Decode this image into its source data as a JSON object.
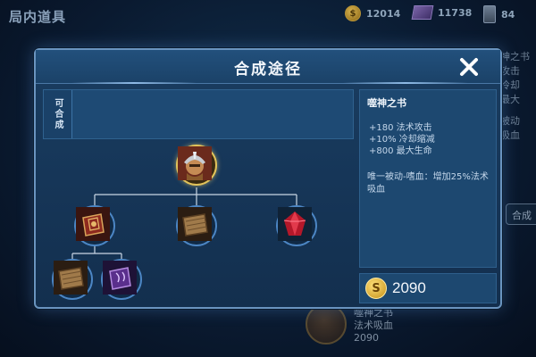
{
  "background": {
    "title": "局内道具",
    "currencies": [
      {
        "icon": "gold-coin-icon",
        "value": "12014"
      },
      {
        "icon": "gem-icon",
        "value": "11738"
      },
      {
        "icon": "ticket-icon",
        "value": "84"
      }
    ],
    "right_fragments": [
      "神之书",
      "攻击",
      "冷却",
      "最大",
      "被动",
      "吸血"
    ],
    "right_button_label": "合成",
    "bottom_item_name": "噬神之书",
    "bottom_item_desc": "法术吸血",
    "bottom_item_price": "2090"
  },
  "modal": {
    "title": "合成途径",
    "close_icon": "close-icon",
    "combine_label": "可合成",
    "tree": {
      "root": {
        "name": "噬神之书",
        "icon": "helmet-warrior-icon"
      },
      "children": [
        {
          "name": "mage-book-icon",
          "icon": "red-tome-icon"
        },
        {
          "name": "wooden-book-icon",
          "icon": "wood-book-icon"
        },
        {
          "name": "red-crystal-icon",
          "icon": "red-crystal-icon"
        }
      ],
      "grandchildren": [
        {
          "name": "wooden-book-icon",
          "icon": "wood-book-icon"
        },
        {
          "name": "purple-scroll-icon",
          "icon": "purple-scroll-icon"
        }
      ]
    },
    "detail": {
      "name": "噬神之书",
      "stats": [
        "+180 法术攻击",
        "+10% 冷却缩减",
        "+800 最大生命"
      ],
      "passive": "唯一被动-嗜血：增加25%法术吸血"
    },
    "price": "2090",
    "colors": {
      "accent": "#6a94bf",
      "gold": "#e2c35a",
      "panel": "#1d4870"
    }
  }
}
